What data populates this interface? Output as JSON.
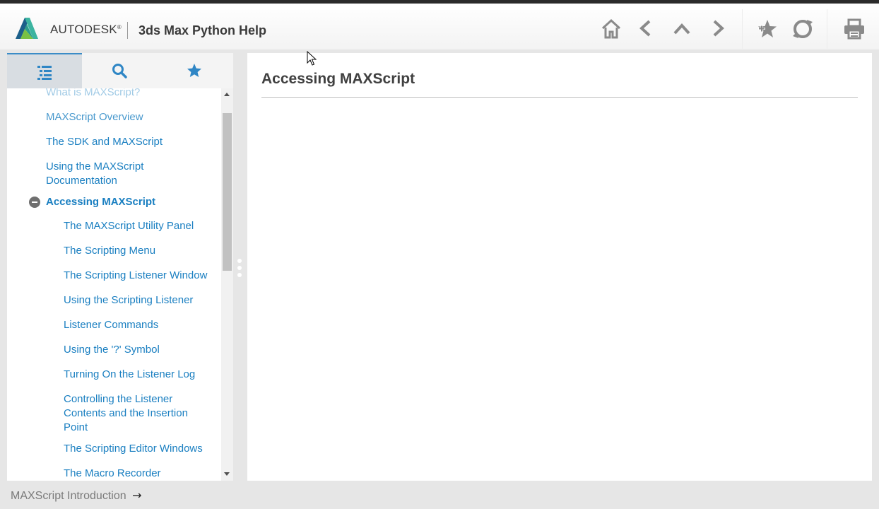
{
  "header": {
    "brand": "AUTODESK",
    "brand_mark": "®",
    "product": "3ds Max Python Help",
    "icons": [
      "home-icon",
      "back-icon",
      "up-icon",
      "forward-icon",
      "favorite-add-icon",
      "sync-icon",
      "print-icon"
    ]
  },
  "left_tabs": {
    "icons": [
      "table-of-contents-icon",
      "search-icon",
      "favorites-star-icon"
    ],
    "active": 0
  },
  "toc": {
    "items": [
      {
        "label": "What is MAXScript?",
        "level": 1
      },
      {
        "label": "MAXScript Overview",
        "level": 1
      },
      {
        "label": "The SDK and MAXScript",
        "level": 1
      },
      {
        "label": "Using the MAXScript Documentation",
        "level": 1
      },
      {
        "label": "Accessing MAXScript",
        "level": 1,
        "expanded": true,
        "selected": true
      },
      {
        "label": "The MAXScript Utility Panel",
        "level": 2
      },
      {
        "label": "The Scripting Menu",
        "level": 2
      },
      {
        "label": "The Scripting Listener Window",
        "level": 2
      },
      {
        "label": "Using the Scripting Listener",
        "level": 2
      },
      {
        "label": "Listener Commands",
        "level": 2
      },
      {
        "label": "Using the '?' Symbol",
        "level": 2
      },
      {
        "label": "Turning On the Listener Log",
        "level": 2
      },
      {
        "label": "Controlling the Listener Contents and the Insertion Point",
        "level": 2
      },
      {
        "label": "The Scripting Editor Windows",
        "level": 2
      },
      {
        "label": "The Macro Recorder",
        "level": 2
      }
    ]
  },
  "content": {
    "title": "Accessing MAXScript"
  },
  "footer": {
    "breadcrumb": "MAXScript Introduction",
    "arrow": "→"
  },
  "colors": {
    "link": "#1a7fc1",
    "active_tab_border": "#3a8cc7",
    "icon_gray": "#8a8a8a"
  }
}
